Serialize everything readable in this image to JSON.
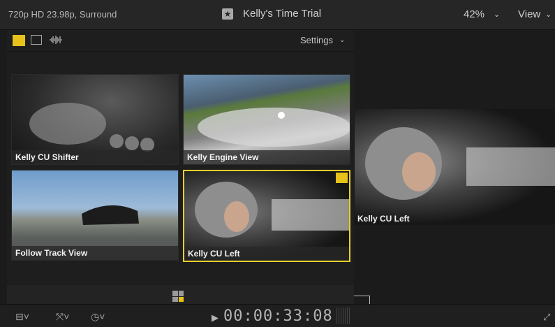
{
  "topbar": {
    "format": "720p HD 23.98p, Surround",
    "title": "Kelly's Time Trial",
    "zoom": "42%",
    "view_label": "View",
    "chevron": "⌄"
  },
  "angle_viewer": {
    "settings_label": "Settings",
    "chevron": "⌄",
    "angles": [
      {
        "label": "Kelly CU Shifter",
        "active": false
      },
      {
        "label": "Kelly Engine View",
        "active": false
      },
      {
        "label": "Follow Track View",
        "active": false
      },
      {
        "label": "Kelly CU Left",
        "active": true
      }
    ]
  },
  "viewer": {
    "clip_label": "Kelly CU Left"
  },
  "transport": {
    "play_glyph": "▶",
    "timecode": "00:00:33:08"
  },
  "colors": {
    "active_angle": "#e8cf2a",
    "background": "#1b1b1b"
  },
  "icons": {
    "audio_video": "audio-video-icon",
    "video_only": "video-icon",
    "audio_only": "waveform-icon",
    "favorite": "star-icon",
    "angle_grid": "grid-icon",
    "fullscreen": "fullscreen-icon"
  }
}
